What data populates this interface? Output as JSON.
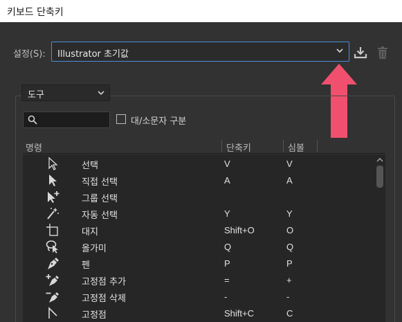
{
  "window": {
    "title": "키보드 단축키"
  },
  "preset": {
    "label": "설정(S):",
    "value": "Illustrator 초기값"
  },
  "category": {
    "value": "도구"
  },
  "search": {
    "placeholder": ""
  },
  "case_option": {
    "label": "대/소문자 구분",
    "checked": false
  },
  "columns": {
    "command": "명령",
    "shortcut": "단축키",
    "symbol": "심볼"
  },
  "rows": [
    {
      "icon": "selection-tool-icon",
      "name": "선택",
      "shortcut": "V",
      "symbol": "V"
    },
    {
      "icon": "direct-selection-tool-icon",
      "name": "직접 선택",
      "shortcut": "A",
      "symbol": "A"
    },
    {
      "icon": "group-selection-tool-icon",
      "name": "그룹 선택",
      "shortcut": "",
      "symbol": ""
    },
    {
      "icon": "magic-wand-tool-icon",
      "name": "자동 선택",
      "shortcut": "Y",
      "symbol": "Y"
    },
    {
      "icon": "artboard-tool-icon",
      "name": "대지",
      "shortcut": "Shift+O",
      "symbol": "O"
    },
    {
      "icon": "lasso-tool-icon",
      "name": "올가미",
      "shortcut": "Q",
      "symbol": "Q"
    },
    {
      "icon": "pen-tool-icon",
      "name": "펜",
      "shortcut": "P",
      "symbol": "P"
    },
    {
      "icon": "add-anchor-point-tool-icon",
      "name": "고정점 추가",
      "shortcut": "=",
      "symbol": "+"
    },
    {
      "icon": "delete-anchor-point-tool-icon",
      "name": "고정점 삭제",
      "shortcut": "-",
      "symbol": "-"
    },
    {
      "icon": "anchor-point-tool-icon",
      "name": "고정점",
      "shortcut": "Shift+C",
      "symbol": "C"
    }
  ],
  "colors": {
    "background": "#323232",
    "focus_border": "#4a8fe0",
    "arrow": "#f0506e",
    "table_bg": "#262626"
  }
}
